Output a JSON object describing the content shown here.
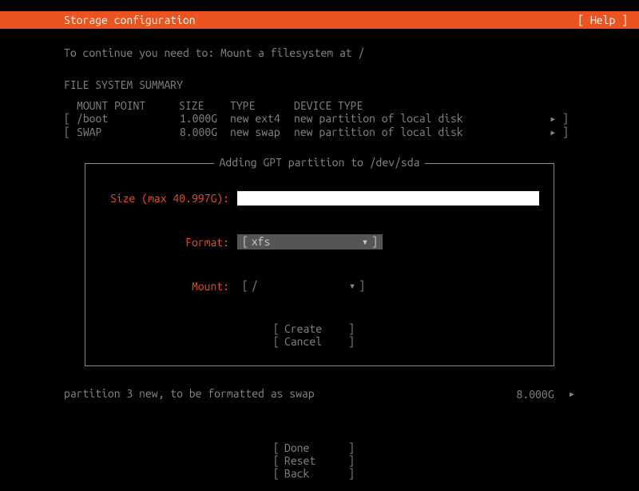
{
  "header": {
    "title": "Storage configuration",
    "help": "[ Help ]"
  },
  "instruction": "To continue you need to: Mount a filesystem at /",
  "section_title": "FILE SYSTEM SUMMARY",
  "fs_header": {
    "mount": "MOUNT POINT",
    "size": "SIZE",
    "type": "TYPE",
    "device": "DEVICE TYPE"
  },
  "fs_rows": [
    {
      "bl": "[",
      "mount": "/boot",
      "size": "1.000G",
      "type": "new ext4",
      "device": "new partition of local disk",
      "arrow": "▸",
      "br": "]"
    },
    {
      "bl": "[",
      "mount": "SWAP",
      "size": "8.000G",
      "type": "new swap",
      "device": "new partition of local disk",
      "arrow": "▸",
      "br": "]"
    }
  ],
  "dialog": {
    "title": " Adding GPT partition to /dev/sda ",
    "size_label": "Size (max 40.997G):",
    "format_label": "Format:",
    "format": {
      "l": "[",
      "val": "xfs",
      "arrow": "▾",
      "r": "]"
    },
    "mount_label": "Mount:",
    "mount": {
      "l": "[",
      "val": "/",
      "arrow": "▾",
      "r": "]"
    },
    "create": {
      "l": "[",
      "txt": "Create",
      "r": "]"
    },
    "cancel": {
      "l": "[",
      "txt": "Cancel",
      "r": "]"
    }
  },
  "status": {
    "text": "partition 3  new, to be formatted as swap",
    "size": "8.000G",
    "arrow": "▸"
  },
  "bottom": {
    "done": {
      "l": "[",
      "txt": "Done",
      "r": "]"
    },
    "reset": {
      "l": "[",
      "txt": "Reset",
      "r": "]"
    },
    "back": {
      "l": "[",
      "txt": "Back",
      "r": "]"
    }
  }
}
